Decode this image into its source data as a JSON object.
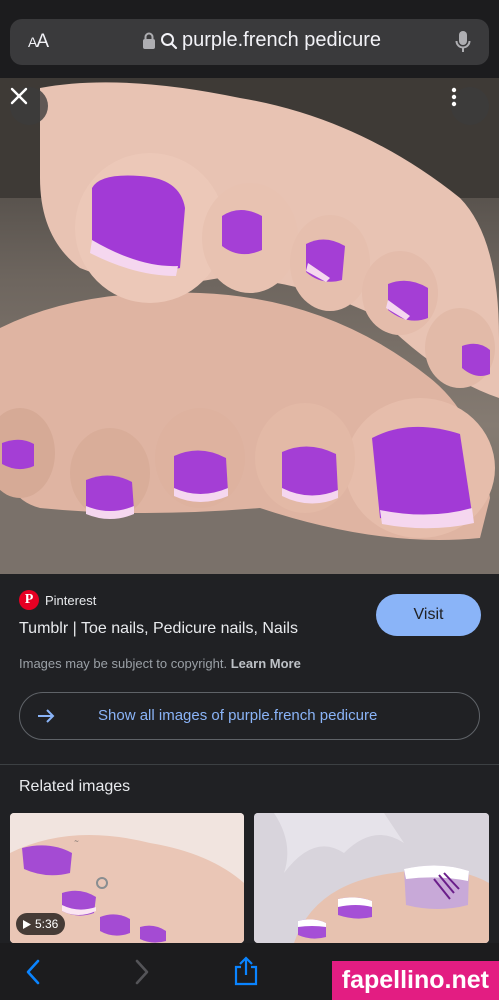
{
  "browser": {
    "text_size_label": "AA",
    "url": "purple.french pedicure",
    "icons": [
      "lock-icon",
      "search-icon",
      "microphone-icon"
    ]
  },
  "viewer": {
    "close_icon": "close-icon",
    "more_icon": "more-vert-icon"
  },
  "result": {
    "source": "Pinterest",
    "title": "Tumblr | Toe nails, Pedicure nails, Nails",
    "visit_label": "Visit",
    "copyright_text": "Images may be subject to copyright.",
    "learn_more_label": "Learn More",
    "show_all_label": "Show all images of purple.french pedicure"
  },
  "related": {
    "heading": "Related images",
    "items": [
      {
        "duration": "5:36",
        "has_video": true
      },
      {
        "has_video": false
      }
    ]
  },
  "toolbar": {
    "icons": [
      "back-icon",
      "forward-icon",
      "share-icon",
      "bookmarks-icon",
      "tabs-icon"
    ]
  },
  "watermark": "fapellino.net",
  "colors": {
    "accent": "#8ab4f8",
    "nail_purple": "#a23ad6",
    "pinterest_red": "#e60023",
    "watermark_pink": "#e31d82"
  }
}
